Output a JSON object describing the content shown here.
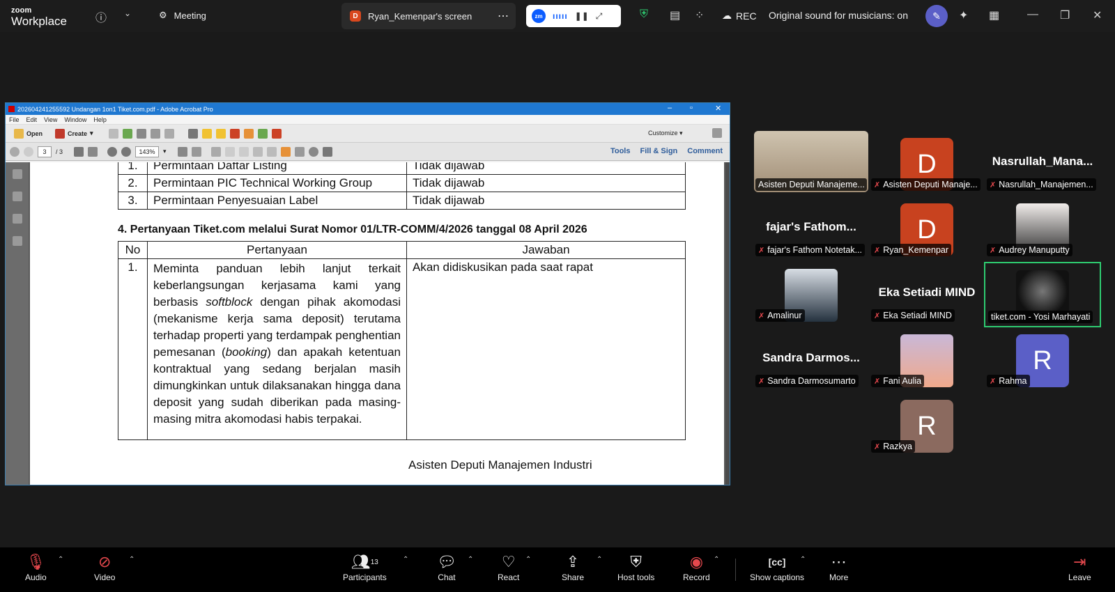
{
  "topbar": {
    "logo_line1": "zoom",
    "logo_line2": "Workplace",
    "meeting_tab_label": "Meeting",
    "screen_tab_label": "Ryan_Kemenpar's screen",
    "screen_tab_badge": "D",
    "zm_badge": "zm",
    "rec_label": "REC",
    "original_sound": "Original sound for musicians: on"
  },
  "acrobat": {
    "title": "202604241255592 Undangan 1on1 Tiket.com.pdf - Adobe Acrobat Pro",
    "menu": [
      "File",
      "Edit",
      "View",
      "Window",
      "Help"
    ],
    "open_label": "Open",
    "create_label": "Create",
    "customize_label": "Customize",
    "page_current": "3",
    "page_total": "/ 3",
    "zoom": "143%",
    "links": [
      "Tools",
      "Fill & Sign",
      "Comment"
    ]
  },
  "document": {
    "table1_rows": [
      {
        "no": "1.",
        "item": "Permintaan Daftar Listing",
        "status": "Tidak dijawab"
      },
      {
        "no": "2.",
        "item": "Permintaan PIC Technical Working Group",
        "status": "Tidak dijawab"
      },
      {
        "no": "3.",
        "item": "Permintaan Penyesuaian Label",
        "status": "Tidak dijawab"
      }
    ],
    "section_title": "4.  Pertanyaan Tiket.com melalui Surat Nomor 01/LTR-COMM/4/2026 tanggal 08 April 2026",
    "table2_headers": [
      "No",
      "Pertanyaan",
      "Jawaban"
    ],
    "table2_row": {
      "no": "1.",
      "question_part1": "Meminta panduan lebih lanjut terkait keberlangsungan kerjasama kami yang berbasis ",
      "question_em1": "softblock",
      "question_part2": " dengan pihak akomodasi (mekanisme kerja sama deposit) terutama terhadap properti yang terdampak penghentian pemesanan (",
      "question_em2": "booking",
      "question_part3": ") dan apakah ketentuan kontraktual yang sedang berjalan masih dimungkinkan untuk dilaksanakan hingga dana deposit yang sudah diberikan pada masing-masing mitra akomodasi habis terpakai.",
      "answer": "Akan didiskusikan pada saat rapat"
    },
    "signature_line": "Asisten Deputi Manajemen Industri"
  },
  "gallery": [
    {
      "name": "Asisten Deputi Manajeme...",
      "display": "photo",
      "big": ""
    },
    {
      "name": "Asisten Deputi Manaje...",
      "display": "avatar",
      "letter": "D",
      "color": "#c8421f"
    },
    {
      "name": "Nasrullah_Manajemen...",
      "display": "name",
      "big": "Nasrullah_Mana..."
    },
    {
      "name": "fajar's Fathom Notetak...",
      "display": "name",
      "big": "fajar's  Fathom..."
    },
    {
      "name": "Ryan_Kemenpar",
      "display": "avatar",
      "letter": "D",
      "color": "#c8421f"
    },
    {
      "name": "Audrey Manuputty",
      "display": "photo"
    },
    {
      "name": "Amalinur",
      "display": "photo"
    },
    {
      "name": "Eka Setiadi MIND",
      "display": "name",
      "big": "Eka Setiadi MIND"
    },
    {
      "name": "tiket.com - Yosi Marhayati",
      "display": "photo",
      "active": true
    },
    {
      "name": "Sandra Darmosumarto",
      "display": "name",
      "big": "Sandra  Darmos..."
    },
    {
      "name": "Fani Aulia",
      "display": "photo"
    },
    {
      "name": "Rahma",
      "display": "avatar",
      "letter": "R",
      "color": "#5b5fc7"
    },
    {
      "name": "Razkya",
      "display": "avatar",
      "letter": "R",
      "color": "#8b6a5f"
    }
  ],
  "controls": {
    "audio": "Audio",
    "video": "Video",
    "participants": "Participants",
    "participants_count": "13",
    "chat": "Chat",
    "react": "React",
    "share": "Share",
    "host_tools": "Host tools",
    "record": "Record",
    "show_captions": "Show captions",
    "more": "More",
    "leave": "Leave"
  }
}
